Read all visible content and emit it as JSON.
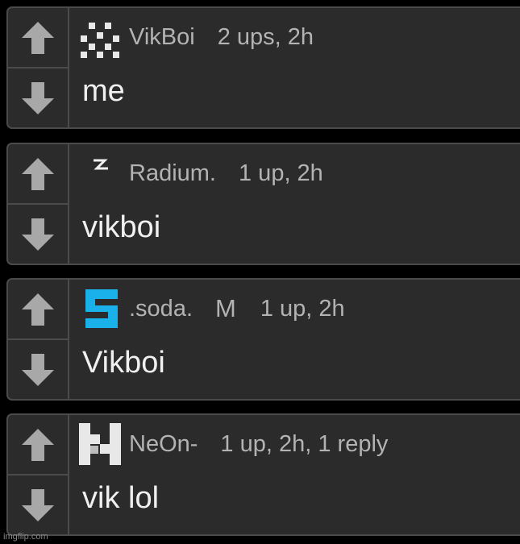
{
  "theme": {
    "card_background": "#2b2b2b",
    "card_border": "#4b4b4b",
    "arrow_color": "#a8a8a8",
    "meta_text_color": "#b3b3b3",
    "body_text_color": "#f0f0f0"
  },
  "icons": {
    "upvote": "arrow-up-icon",
    "downvote": "arrow-down-icon"
  },
  "comments": [
    {
      "username": "VikBoi",
      "mod_badge": "",
      "meta": "2 ups, 2h",
      "text": "me",
      "avatar": "checker-pattern-avatar"
    },
    {
      "username": "Radium.",
      "mod_badge": "",
      "meta": "1 up, 2h",
      "text": "vikboi",
      "avatar": "zigzag-avatar"
    },
    {
      "username": ".soda.",
      "mod_badge": "M",
      "meta": "1 up, 2h",
      "text": "Vikboi",
      "avatar": "blue-s-avatar",
      "avatar_color": "#1ab0ea"
    },
    {
      "username": "NeOn-",
      "mod_badge": "",
      "meta": "1 up, 2h, 1 reply",
      "text": "vik lol",
      "avatar": "white-n-avatar"
    }
  ],
  "watermark": "imgflip.com"
}
